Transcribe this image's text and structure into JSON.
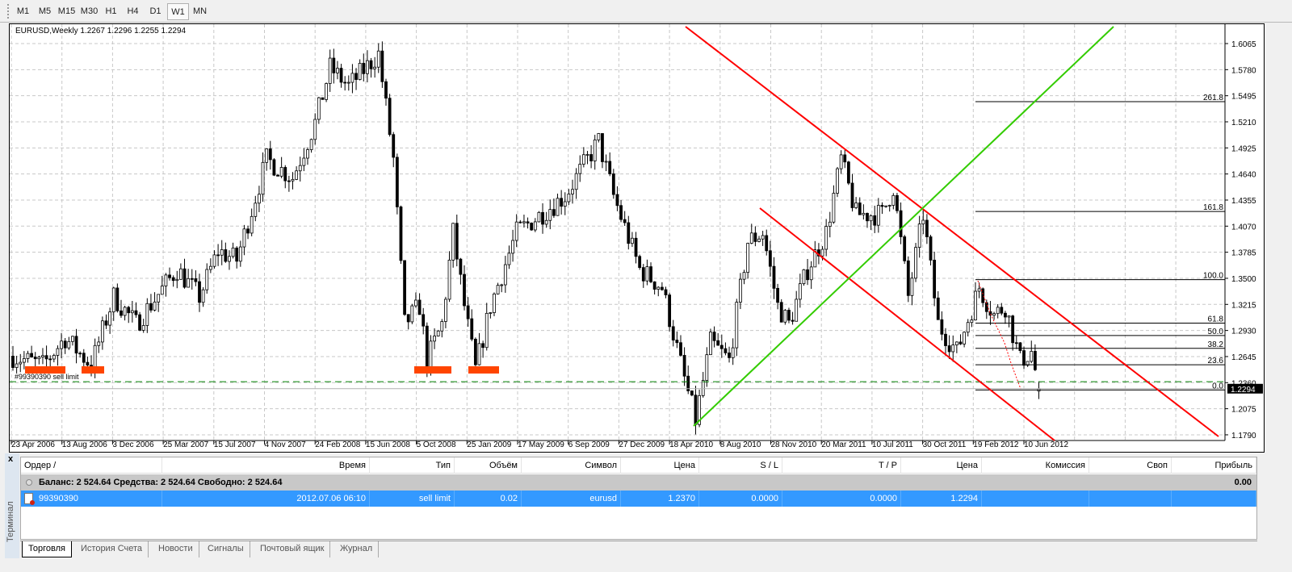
{
  "timeframes": [
    "M1",
    "M5",
    "M15",
    "M30",
    "H1",
    "H4",
    "D1",
    "W1",
    "MN"
  ],
  "active_timeframe": "W1",
  "chart": {
    "title": "EURUSD,Weekly  1.2267 1.2296 1.2255 1.2294",
    "order_label": "#99390390 sell limit",
    "current_price": "1.2294",
    "colors": {
      "channel": "#ff0000",
      "trend": "#33cc00",
      "order_line": "#008000",
      "zones": "#ff4500"
    }
  },
  "chart_data": {
    "type": "candlestick",
    "symbol": "EURUSD",
    "period": "Weekly",
    "ohlc_last": {
      "open": 1.2267,
      "high": 1.2296,
      "low": 1.2255,
      "close": 1.2294
    },
    "ylim": [
      1.172,
      1.625
    ],
    "y_ticks": [
      "1.6065",
      "1.5780",
      "1.5495",
      "1.5210",
      "1.4925",
      "1.4640",
      "1.4355",
      "1.4070",
      "1.3785",
      "1.3500",
      "1.3215",
      "1.2930",
      "1.2645",
      "1.2360",
      "1.2075",
      "1.1790"
    ],
    "x_ticks": [
      "23 Apr 2006",
      "13 Aug 2006",
      "3 Dec 2006",
      "25 Mar 2007",
      "15 Jul 2007",
      "4 Nov 2007",
      "24 Feb 2008",
      "15 Jun 2008",
      "5 Oct 2008",
      "25 Jan 2009",
      "17 May 2009",
      "6 Sep 2009",
      "27 Dec 2009",
      "18 Apr 2010",
      "8 Aug 2010",
      "28 Nov 2010",
      "20 Mar 2011",
      "10 Jul 2011",
      "30 Oct 2011",
      "19 Feb 2012",
      "10 Jun 2012"
    ],
    "approx_path_week_close": [
      [
        0,
        1.265
      ],
      [
        8,
        1.255
      ],
      [
        14,
        1.285
      ],
      [
        21,
        1.255
      ],
      [
        27,
        1.33
      ],
      [
        33,
        1.3
      ],
      [
        44,
        1.36
      ],
      [
        50,
        1.33
      ],
      [
        55,
        1.38
      ],
      [
        60,
        1.37
      ],
      [
        68,
        1.48
      ],
      [
        75,
        1.46
      ],
      [
        81,
        1.52
      ],
      [
        85,
        1.58
      ],
      [
        90,
        1.56
      ],
      [
        98,
        1.595
      ],
      [
        102,
        1.48
      ],
      [
        105,
        1.3
      ],
      [
        109,
        1.32
      ],
      [
        111,
        1.26
      ],
      [
        115,
        1.3
      ],
      [
        118,
        1.4
      ],
      [
        121,
        1.32
      ],
      [
        124,
        1.25
      ],
      [
        128,
        1.32
      ],
      [
        135,
        1.4
      ],
      [
        148,
        1.44
      ],
      [
        157,
        1.5
      ],
      [
        161,
        1.44
      ],
      [
        168,
        1.36
      ],
      [
        174,
        1.34
      ],
      [
        180,
        1.24
      ],
      [
        183,
        1.195
      ],
      [
        187,
        1.28
      ],
      [
        192,
        1.26
      ],
      [
        197,
        1.39
      ],
      [
        201,
        1.4
      ],
      [
        205,
        1.32
      ],
      [
        208,
        1.3
      ],
      [
        213,
        1.36
      ],
      [
        218,
        1.4
      ],
      [
        222,
        1.48
      ],
      [
        226,
        1.42
      ],
      [
        233,
        1.42
      ],
      [
        236,
        1.45
      ],
      [
        240,
        1.33
      ],
      [
        244,
        1.42
      ],
      [
        248,
        1.3
      ],
      [
        253,
        1.27
      ],
      [
        259,
        1.34
      ],
      [
        263,
        1.31
      ],
      [
        266,
        1.32
      ],
      [
        270,
        1.26
      ],
      [
        273,
        1.27
      ],
      [
        275,
        1.2294
      ]
    ],
    "fibonacci": [
      {
        "level": "261.8",
        "price": 1.543
      },
      {
        "level": "161.8",
        "price": 1.423
      },
      {
        "level": "100.0",
        "price": 1.3485
      },
      {
        "level": "61.8",
        "price": 1.301
      },
      {
        "level": "50.0",
        "price": 1.2875
      },
      {
        "level": "38.2",
        "price": 1.2735
      },
      {
        "level": "23.6",
        "price": 1.2555
      },
      {
        "level": "0.0",
        "price": 1.228
      }
    ],
    "sell_limit_price": 1.237
  },
  "terminal": {
    "close": "x",
    "side_label": "Терминал",
    "columns": [
      "Ордер  /",
      "Время",
      "Тип",
      "Объём",
      "Символ",
      "Цена",
      "S / L",
      "T / P",
      "Цена",
      "Комиссия",
      "Своп",
      "Прибыль"
    ],
    "balance_text": "Баланс: 2 524.64  Средства: 2 524.64  Свободно: 2 524.64",
    "balance_profit": "0.00",
    "orders": [
      {
        "order": "99390390",
        "time": "2012.07.06 06:10",
        "type": "sell limit",
        "volume": "0.02",
        "symbol": "eurusd",
        "price": "1.2370",
        "sl": "0.0000",
        "tp": "0.0000",
        "cur_price": "1.2294",
        "commission": "",
        "swap": "",
        "profit": ""
      }
    ],
    "tabs": [
      "Торговля",
      "История Счета",
      "Новости",
      "Сигналы",
      "Почтовый ящик",
      "Журнал"
    ],
    "active_tab": "Торговля"
  }
}
